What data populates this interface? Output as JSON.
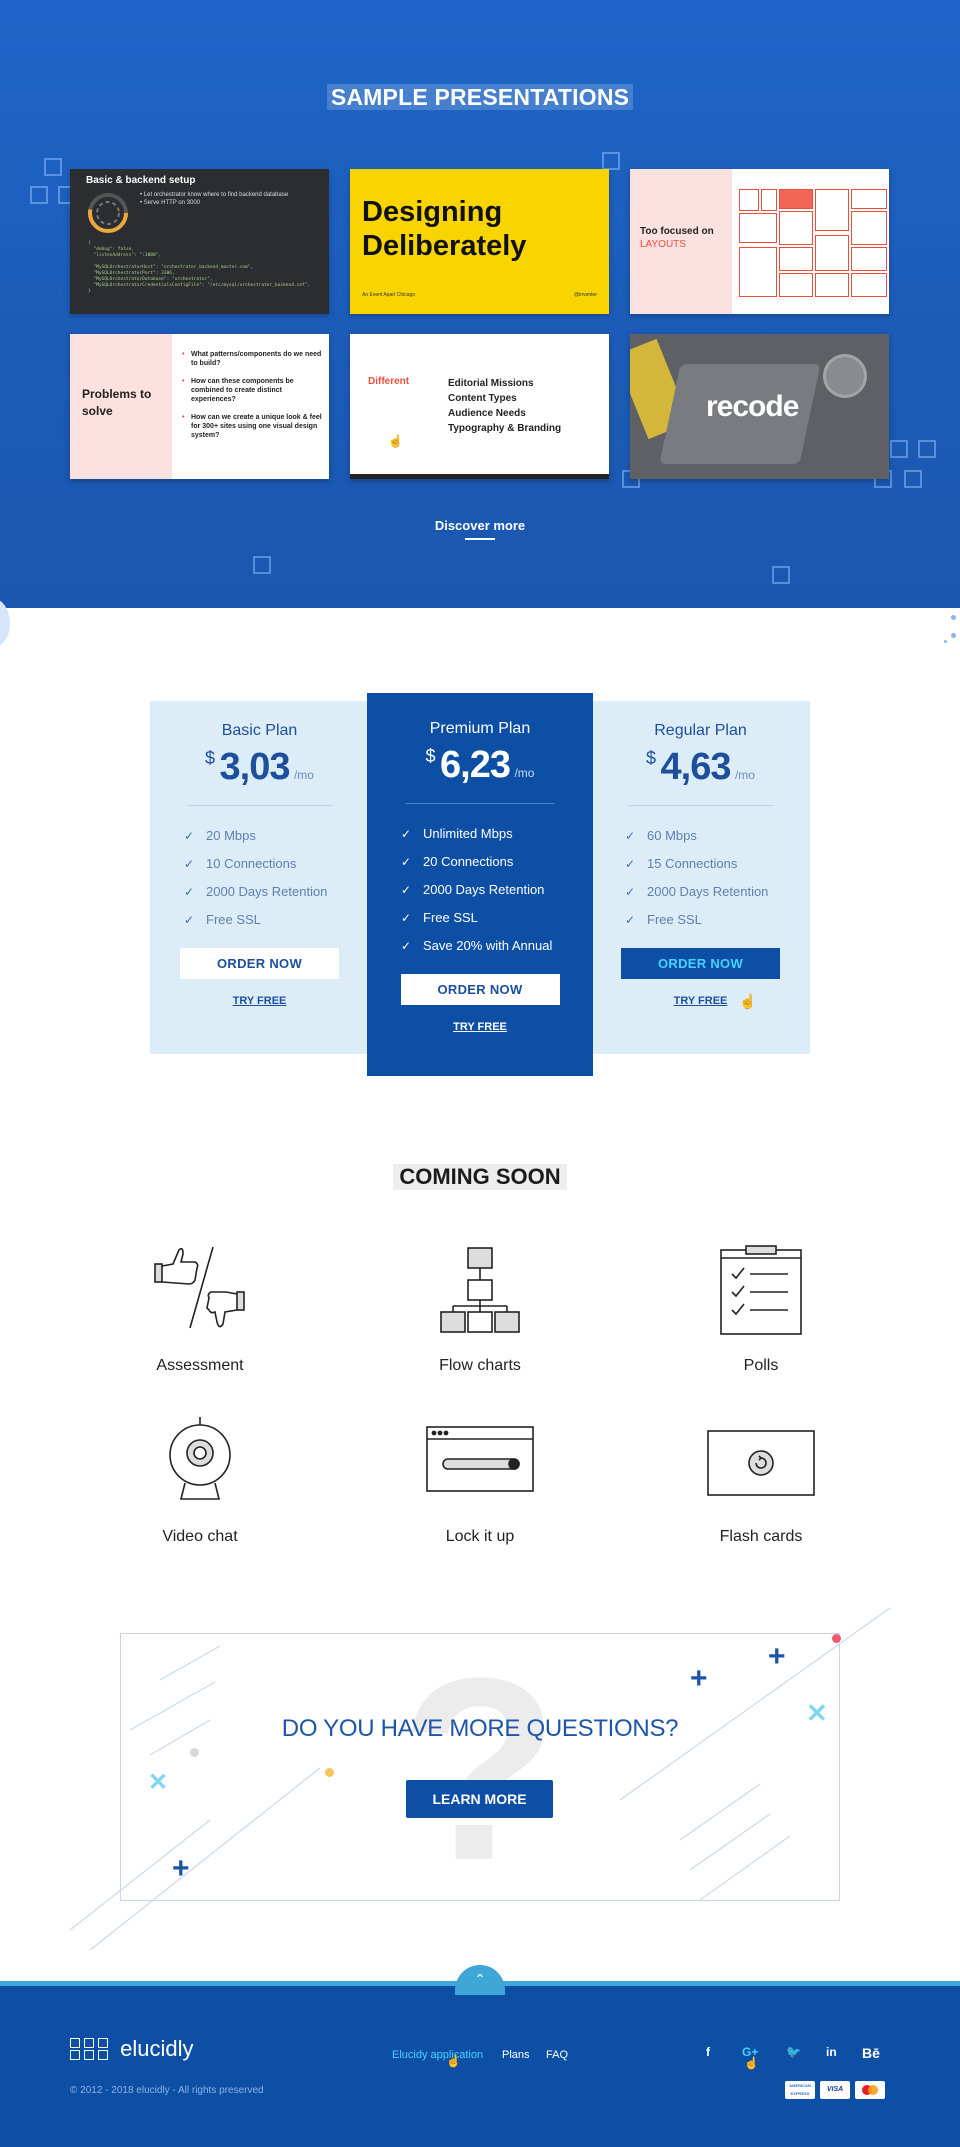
{
  "presentations": {
    "title": "SAMPLE PRESENTATIONS",
    "discover": "Discover more",
    "slides": {
      "s1": {
        "title": "Basic & backend setup",
        "bullets": "• Let orchestrator know where to find backend database\n• Serve HTTP on 3000"
      },
      "s2": {
        "title": "Designing Deliberately",
        "foot_left": "An Event Apart Chicago",
        "foot_right": "@inventer"
      },
      "s3": {
        "title": "Too focused on",
        "accent": "LAYOUTS"
      },
      "s4": {
        "title": "Problems to solve",
        "items": [
          "What patterns/components do we need to build?",
          "How can these components be combined to create distinct experiences?",
          "How can we create a unique look & feel for 300+ sites using one visual design system?"
        ]
      },
      "s5": {
        "label": "Different",
        "items": [
          "Editorial Missions",
          "Content Types",
          "Audience Needs",
          "Typography & Branding"
        ]
      },
      "s6": {
        "title": "recode"
      }
    }
  },
  "pricing": {
    "currency": "$",
    "per": "/mo",
    "order_label": "ORDER NOW",
    "try_label": "TRY FREE",
    "basic": {
      "name": "Basic Plan",
      "price": "3,03",
      "features": [
        "20 Mbps",
        "10 Connections",
        "2000 Days Retention",
        "Free SSL"
      ]
    },
    "premium": {
      "name": "Premium Plan",
      "price": "6,23",
      "features": [
        "Unlimited Mbps",
        "20 Connections",
        "2000 Days Retention",
        "Free SSL",
        "Save 20% with Annual"
      ]
    },
    "regular": {
      "name": "Regular Plan",
      "price": "4,63",
      "features": [
        "60 Mbps",
        "15 Connections",
        "2000 Days Retention",
        "Free SSL"
      ]
    }
  },
  "coming_soon": {
    "title": "COMING SOON",
    "features": [
      "Assessment",
      "Flow charts",
      "Polls",
      "Video chat",
      "Lock it up",
      "Flash cards"
    ]
  },
  "questions": {
    "title": "DO YOU HAVE MORE QUESTIONS?",
    "button": "LEARN MORE"
  },
  "footer": {
    "logo": "elucidly",
    "copyright": "© 2012 - 2018 elucidly - All rights preserved",
    "nav": [
      "Elucidy application",
      "Plans",
      "FAQ"
    ],
    "social": [
      "f",
      "G+",
      "t",
      "in",
      "Bē"
    ],
    "cards": [
      "AMERICAN EXPRESS",
      "VISA",
      "mastercard"
    ]
  },
  "colors": {
    "brand_blue": "#0e4fa6",
    "accent_cyan": "#44d3ff",
    "light_blue": "#dcedf8",
    "red_accent": "#e94f3d"
  }
}
